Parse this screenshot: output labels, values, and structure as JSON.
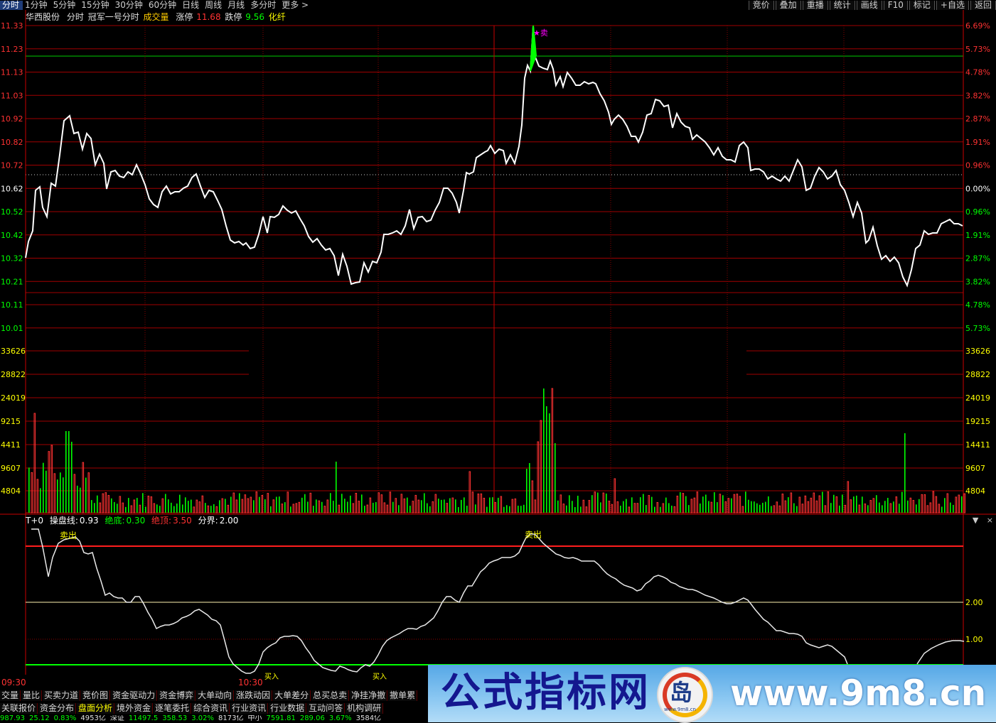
{
  "topbar": {
    "tabs": [
      "分时",
      "1分钟",
      "5分钟",
      "15分钟",
      "30分钟",
      "60分钟",
      "日线",
      "周线",
      "月线",
      "多分时",
      "更多 >"
    ],
    "right_buttons": [
      "竞价",
      "叠加",
      "重播",
      "统计",
      "画线",
      "F10",
      "标记",
      "+自选",
      "返回"
    ]
  },
  "info": {
    "stock_name": "华西股份",
    "mode": "分时",
    "indicator_name": "冠军一号分时",
    "volume_label": "成交量",
    "limit_up_label": "涨停",
    "limit_up_value": "11.68",
    "limit_down_label": "跌停",
    "limit_down_value": "9.56",
    "sector": "化纤"
  },
  "colors": {
    "up": "#ff3232",
    "down": "#00ff00",
    "price_line": "#ffffff",
    "grid": "#a00000",
    "label_white": "#ffffff",
    "yellow": "#ffff00",
    "magenta": "#ff00ff"
  },
  "axes": {
    "price_left": [
      "11.33",
      "11.23",
      "11.13",
      "11.03",
      "10.92",
      "10.82",
      "10.72",
      "10.62",
      "10.52",
      "10.42",
      "10.32",
      "10.21",
      "10.11",
      "10.01"
    ],
    "price_right": [
      "6.69%",
      "5.73%",
      "4.78%",
      "3.82%",
      "2.87%",
      "1.91%",
      "0.96%",
      "0.00%",
      "0.96%",
      "1.91%",
      "2.87%",
      "3.82%",
      "4.78%",
      "5.73%"
    ],
    "volume_left": [
      "33626",
      "28822",
      "24019",
      "9215",
      "4411",
      "9607",
      "4804"
    ],
    "volume_right": [
      "33626",
      "28822",
      "24019",
      "19215",
      "14411",
      "9607",
      "4804"
    ],
    "indicator_right": [
      "2.00",
      "1.00"
    ],
    "time_labels": [
      "09:30",
      "10:30"
    ]
  },
  "chart_data": {
    "type": "line",
    "price": {
      "reference": 10.62,
      "high": 11.33,
      "low": 10.01
    },
    "signals": [
      {
        "label": "卖",
        "color": "#ff00ff"
      },
      {
        "label": "卖出",
        "color": "#ffff00"
      },
      {
        "label": "卖出",
        "color": "#ffff00"
      },
      {
        "label": "买入",
        "color": "#ffff00"
      },
      {
        "label": "买入",
        "color": "#ffff00"
      }
    ]
  },
  "indicator": {
    "prefix": "T+0",
    "line_label": "操盘线:",
    "line_value": "0.93",
    "bottom_label": "绝底:",
    "bottom_value": "0.30",
    "top_label": "绝顶:",
    "top_value": "3.50",
    "boundary_label": "分界:",
    "boundary_value": "2.00",
    "ctrl_down": "▼",
    "ctrl_close": "×"
  },
  "bottom_tabs_row1": [
    "交量",
    "量比",
    "买卖力道",
    "竞价图",
    "资金驱动力",
    "资金博弈",
    "大单动向",
    "涨跌动因",
    "大单差分",
    "总买总卖",
    "净挂净撤",
    "撤单累"
  ],
  "bottom_tabs_row2": [
    "关联报价",
    "资金分布",
    "盘面分析",
    "境外资金",
    "逐笔委托",
    "综合资讯",
    "行业资讯",
    "行业数据",
    "互动问答",
    "机构调研"
  ],
  "ticker": [
    "987.93",
    "25.12",
    "0.83%",
    "4953亿",
    "深证",
    "11497.5",
    "358.53",
    "3.02%",
    "8173亿",
    "中小",
    "7591.81",
    "289.06",
    "3.67%",
    "3584亿"
  ],
  "banner": {
    "site_name": "公式指标网",
    "logo_char": "岛",
    "logo_small": "www.9m8.cn",
    "url": "www.9m8.cn"
  }
}
